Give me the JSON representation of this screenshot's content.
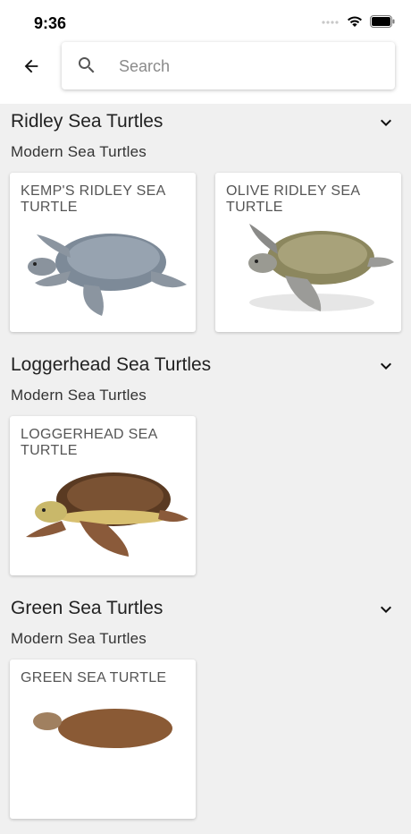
{
  "status_bar": {
    "time": "9:36"
  },
  "search": {
    "placeholder": "Search",
    "value": ""
  },
  "sections": [
    {
      "title": "Ridley Sea Turtles",
      "subtitle": "Modern Sea Turtles",
      "cards": [
        {
          "title": "KEMP'S RIDLEY SEA TURTLE"
        },
        {
          "title": "OLIVE RIDLEY SEA TURTLE"
        }
      ]
    },
    {
      "title": "Loggerhead Sea Turtles",
      "subtitle": "Modern Sea Turtles",
      "cards": [
        {
          "title": "LOGGERHEAD SEA TURTLE"
        }
      ]
    },
    {
      "title": "Green Sea Turtles",
      "subtitle": "Modern Sea Turtles",
      "cards": [
        {
          "title": "GREEN SEA TURTLE"
        }
      ]
    }
  ],
  "icons": {
    "back": "arrow-left-icon",
    "search": "search-icon",
    "expand": "chevron-down-icon"
  },
  "colors": {
    "background": "#f0f0f0",
    "card": "#ffffff",
    "card_title": "#555555"
  }
}
